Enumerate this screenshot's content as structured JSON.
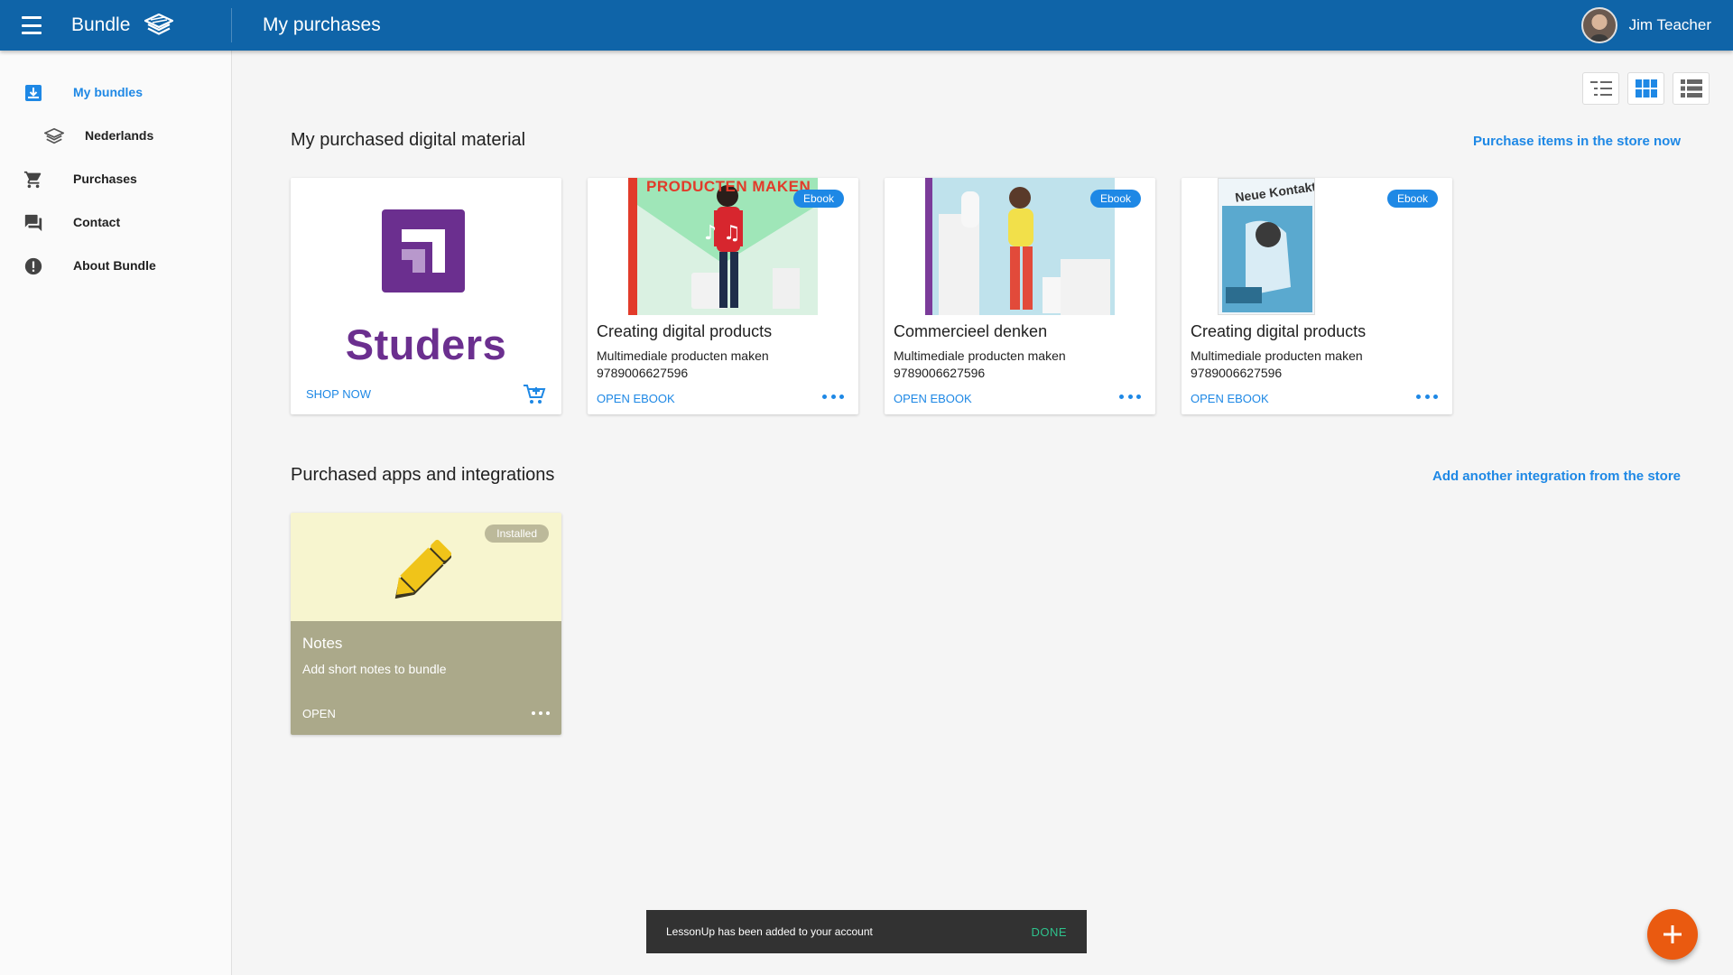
{
  "header": {
    "brand": "Bundle",
    "page_title": "My purchases",
    "user_name": "Jim Teacher"
  },
  "sidebar": {
    "items": [
      {
        "label": "My bundles",
        "icon": "download-box-icon",
        "active": true
      },
      {
        "label": "Nederlands",
        "icon": "layers-icon",
        "sub": true
      },
      {
        "label": "Purchases",
        "icon": "cart-icon"
      },
      {
        "label": "Contact",
        "icon": "chat-icon"
      },
      {
        "label": "About Bundle",
        "icon": "info-icon"
      }
    ]
  },
  "view_toggles": [
    "tree-list-view",
    "grid-view",
    "list-view"
  ],
  "digital": {
    "title": "My purchased digital material",
    "link": "Purchase items in the store now",
    "store_card": {
      "brand": "Studers",
      "action": "SHOP NOW"
    },
    "products": [
      {
        "badge": "Ebook",
        "title": "Creating digital products",
        "subtitle": "Multimediale producten maken",
        "isbn": "9789006627596",
        "action": "OPEN EBOOK",
        "cover_text": "PRODUCTEN MAKEN"
      },
      {
        "badge": "Ebook",
        "title": "Commercieel denken",
        "subtitle": "Multimediale producten maken",
        "isbn": "9789006627596",
        "action": "OPEN EBOOK"
      },
      {
        "badge": "Ebook",
        "title": "Creating digital products",
        "subtitle": "Multimediale producten maken",
        "isbn": "9789006627596",
        "action": "OPEN EBOOK",
        "cover_text": "Neue Kontakte"
      }
    ]
  },
  "apps": {
    "title": "Purchased apps and integrations",
    "link": "Add another integration from the store",
    "notes": {
      "badge": "Installed",
      "title": "Notes",
      "description": "Add short notes to bundle",
      "action": "OPEN"
    }
  },
  "snackbar": {
    "message": "LessonUp has been added to your account",
    "action": "DONE"
  },
  "colors": {
    "header": "#0f64a8",
    "accent": "#1e88e5",
    "fab": "#ea5a10",
    "studers_purple": "#6b2f8f"
  }
}
